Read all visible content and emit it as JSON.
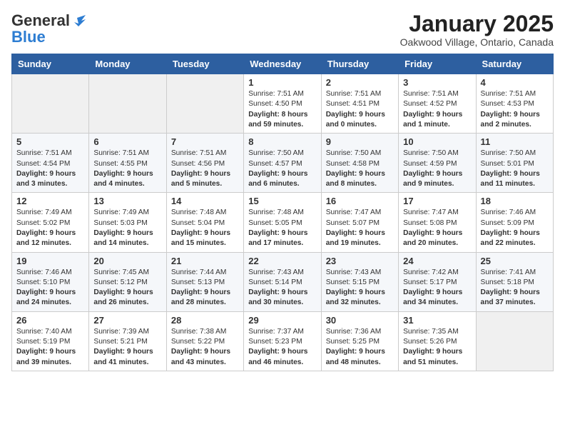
{
  "header": {
    "logo_line1": "General",
    "logo_line2": "Blue",
    "month": "January 2025",
    "location": "Oakwood Village, Ontario, Canada"
  },
  "weekdays": [
    "Sunday",
    "Monday",
    "Tuesday",
    "Wednesday",
    "Thursday",
    "Friday",
    "Saturday"
  ],
  "weeks": [
    [
      {
        "day": "",
        "content": ""
      },
      {
        "day": "",
        "content": ""
      },
      {
        "day": "",
        "content": ""
      },
      {
        "day": "1",
        "content": "Sunrise: 7:51 AM\nSunset: 4:50 PM\nDaylight: 8 hours and 59 minutes."
      },
      {
        "day": "2",
        "content": "Sunrise: 7:51 AM\nSunset: 4:51 PM\nDaylight: 9 hours and 0 minutes."
      },
      {
        "day": "3",
        "content": "Sunrise: 7:51 AM\nSunset: 4:52 PM\nDaylight: 9 hours and 1 minute."
      },
      {
        "day": "4",
        "content": "Sunrise: 7:51 AM\nSunset: 4:53 PM\nDaylight: 9 hours and 2 minutes."
      }
    ],
    [
      {
        "day": "5",
        "content": "Sunrise: 7:51 AM\nSunset: 4:54 PM\nDaylight: 9 hours and 3 minutes."
      },
      {
        "day": "6",
        "content": "Sunrise: 7:51 AM\nSunset: 4:55 PM\nDaylight: 9 hours and 4 minutes."
      },
      {
        "day": "7",
        "content": "Sunrise: 7:51 AM\nSunset: 4:56 PM\nDaylight: 9 hours and 5 minutes."
      },
      {
        "day": "8",
        "content": "Sunrise: 7:50 AM\nSunset: 4:57 PM\nDaylight: 9 hours and 6 minutes."
      },
      {
        "day": "9",
        "content": "Sunrise: 7:50 AM\nSunset: 4:58 PM\nDaylight: 9 hours and 8 minutes."
      },
      {
        "day": "10",
        "content": "Sunrise: 7:50 AM\nSunset: 4:59 PM\nDaylight: 9 hours and 9 minutes."
      },
      {
        "day": "11",
        "content": "Sunrise: 7:50 AM\nSunset: 5:01 PM\nDaylight: 9 hours and 11 minutes."
      }
    ],
    [
      {
        "day": "12",
        "content": "Sunrise: 7:49 AM\nSunset: 5:02 PM\nDaylight: 9 hours and 12 minutes."
      },
      {
        "day": "13",
        "content": "Sunrise: 7:49 AM\nSunset: 5:03 PM\nDaylight: 9 hours and 14 minutes."
      },
      {
        "day": "14",
        "content": "Sunrise: 7:48 AM\nSunset: 5:04 PM\nDaylight: 9 hours and 15 minutes."
      },
      {
        "day": "15",
        "content": "Sunrise: 7:48 AM\nSunset: 5:05 PM\nDaylight: 9 hours and 17 minutes."
      },
      {
        "day": "16",
        "content": "Sunrise: 7:47 AM\nSunset: 5:07 PM\nDaylight: 9 hours and 19 minutes."
      },
      {
        "day": "17",
        "content": "Sunrise: 7:47 AM\nSunset: 5:08 PM\nDaylight: 9 hours and 20 minutes."
      },
      {
        "day": "18",
        "content": "Sunrise: 7:46 AM\nSunset: 5:09 PM\nDaylight: 9 hours and 22 minutes."
      }
    ],
    [
      {
        "day": "19",
        "content": "Sunrise: 7:46 AM\nSunset: 5:10 PM\nDaylight: 9 hours and 24 minutes."
      },
      {
        "day": "20",
        "content": "Sunrise: 7:45 AM\nSunset: 5:12 PM\nDaylight: 9 hours and 26 minutes."
      },
      {
        "day": "21",
        "content": "Sunrise: 7:44 AM\nSunset: 5:13 PM\nDaylight: 9 hours and 28 minutes."
      },
      {
        "day": "22",
        "content": "Sunrise: 7:43 AM\nSunset: 5:14 PM\nDaylight: 9 hours and 30 minutes."
      },
      {
        "day": "23",
        "content": "Sunrise: 7:43 AM\nSunset: 5:15 PM\nDaylight: 9 hours and 32 minutes."
      },
      {
        "day": "24",
        "content": "Sunrise: 7:42 AM\nSunset: 5:17 PM\nDaylight: 9 hours and 34 minutes."
      },
      {
        "day": "25",
        "content": "Sunrise: 7:41 AM\nSunset: 5:18 PM\nDaylight: 9 hours and 37 minutes."
      }
    ],
    [
      {
        "day": "26",
        "content": "Sunrise: 7:40 AM\nSunset: 5:19 PM\nDaylight: 9 hours and 39 minutes."
      },
      {
        "day": "27",
        "content": "Sunrise: 7:39 AM\nSunset: 5:21 PM\nDaylight: 9 hours and 41 minutes."
      },
      {
        "day": "28",
        "content": "Sunrise: 7:38 AM\nSunset: 5:22 PM\nDaylight: 9 hours and 43 minutes."
      },
      {
        "day": "29",
        "content": "Sunrise: 7:37 AM\nSunset: 5:23 PM\nDaylight: 9 hours and 46 minutes."
      },
      {
        "day": "30",
        "content": "Sunrise: 7:36 AM\nSunset: 5:25 PM\nDaylight: 9 hours and 48 minutes."
      },
      {
        "day": "31",
        "content": "Sunrise: 7:35 AM\nSunset: 5:26 PM\nDaylight: 9 hours and 51 minutes."
      },
      {
        "day": "",
        "content": ""
      }
    ]
  ]
}
